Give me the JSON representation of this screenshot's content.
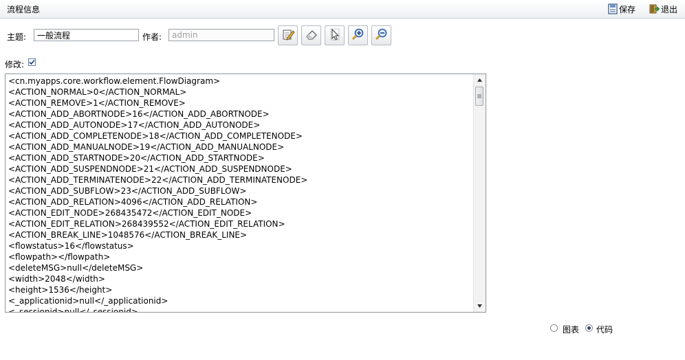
{
  "header": {
    "title": "流程信息",
    "save_label": "保存",
    "exit_label": "退出"
  },
  "form": {
    "subject_label": "主题:",
    "subject_value": "一般流程",
    "author_label": "作者:",
    "author_value": "admin",
    "modify_label": "修改:",
    "modify_checked": true
  },
  "toolbar": {
    "icons": [
      "edit-icon",
      "eraser-icon",
      "pointer-icon",
      "zoom-in-icon",
      "zoom-out-icon"
    ]
  },
  "code": {
    "lines": [
      "<cn.myapps.core.workflow.element.FlowDiagram>",
      "<ACTION_NORMAL>0</ACTION_NORMAL>",
      "<ACTION_REMOVE>1</ACTION_REMOVE>",
      "<ACTION_ADD_ABORTNODE>16</ACTION_ADD_ABORTNODE>",
      "<ACTION_ADD_AUTONODE>17</ACTION_ADD_AUTONODE>",
      "<ACTION_ADD_COMPLETENODE>18</ACTION_ADD_COMPLETENODE>",
      "<ACTION_ADD_MANUALNODE>19</ACTION_ADD_MANUALNODE>",
      "<ACTION_ADD_STARTNODE>20</ACTION_ADD_STARTNODE>",
      "<ACTION_ADD_SUSPENDNODE>21</ACTION_ADD_SUSPENDNODE>",
      "<ACTION_ADD_TERMINATENODE>22</ACTION_ADD_TERMINATENODE>",
      "<ACTION_ADD_SUBFLOW>23</ACTION_ADD_SUBFLOW>",
      "<ACTION_ADD_RELATION>4096</ACTION_ADD_RELATION>",
      "<ACTION_EDIT_NODE>268435472</ACTION_EDIT_NODE>",
      "<ACTION_EDIT_RELATION>268439552</ACTION_EDIT_RELATION>",
      "<ACTION_BREAK_LINE>1048576</ACTION_BREAK_LINE>",
      "<flowstatus>16</flowstatus>",
      "<flowpath></flowpath>",
      "<deleteMSG>null</deleteMSG>",
      "<width>2048</width>",
      "<height>1536</height>",
      "<_applicationid>null</_applicationid>",
      "<_sessionid>null</_sessionid>"
    ]
  },
  "view": {
    "chart_label": "图表",
    "code_label": "代码",
    "selected": "code"
  }
}
